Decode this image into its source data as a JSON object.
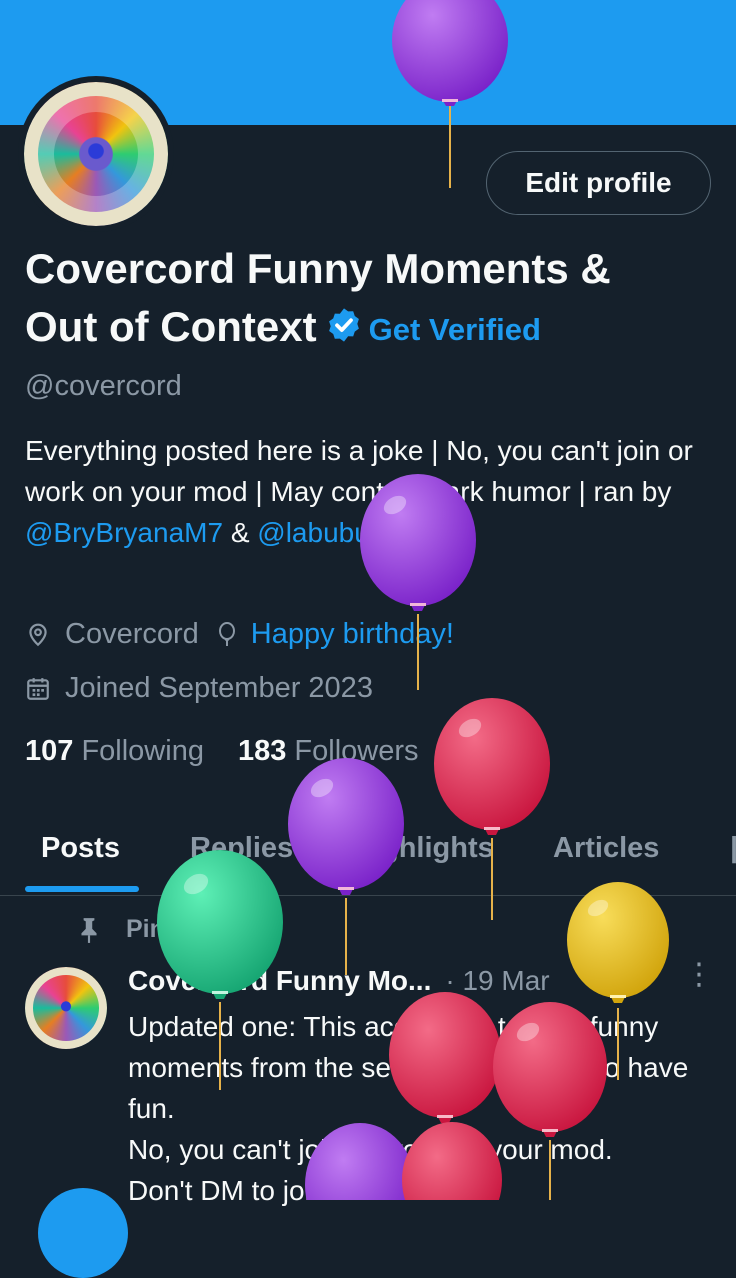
{
  "profile": {
    "edit_button": "Edit profile",
    "name_line1": "Covercord Funny Moments &",
    "name_line2": "Out of Context",
    "get_verified": "Get Verified",
    "handle": "@covercord",
    "bio": {
      "part1": "Everything posted here is a joke | No, you can't join or work on your mod | May contain dark humor | ran by ",
      "mention1": "@BryBryanaM7",
      "part2": " & ",
      "mention2": "@labubusfrotting"
    },
    "location": "Covercord",
    "birthday": "Happy birthday!",
    "joined": "Joined September 2023",
    "following_count": "107",
    "following_label": "Following",
    "followers_count": "183",
    "followers_label": "Followers"
  },
  "tabs": [
    "Posts",
    "Replies",
    "Highlights",
    "Articles"
  ],
  "post": {
    "pinned_label": "Pinned",
    "author": "Covercord Funny Mo...",
    "date": "· 19 Mar",
    "text": "Updated one: This account is to post funny moments from the server and to here to have fun.\nNo, you can't join or work on your mod.\nDon't DM to join"
  },
  "colors": {
    "background": "#15202b",
    "banner": "#1d9bf0",
    "accent": "#1d9bf0",
    "muted_text": "#8b98a5"
  },
  "icons": [
    "location-pin-icon",
    "balloon-icon",
    "calendar-icon",
    "verified-badge-icon",
    "pin-icon",
    "more-icon"
  ]
}
